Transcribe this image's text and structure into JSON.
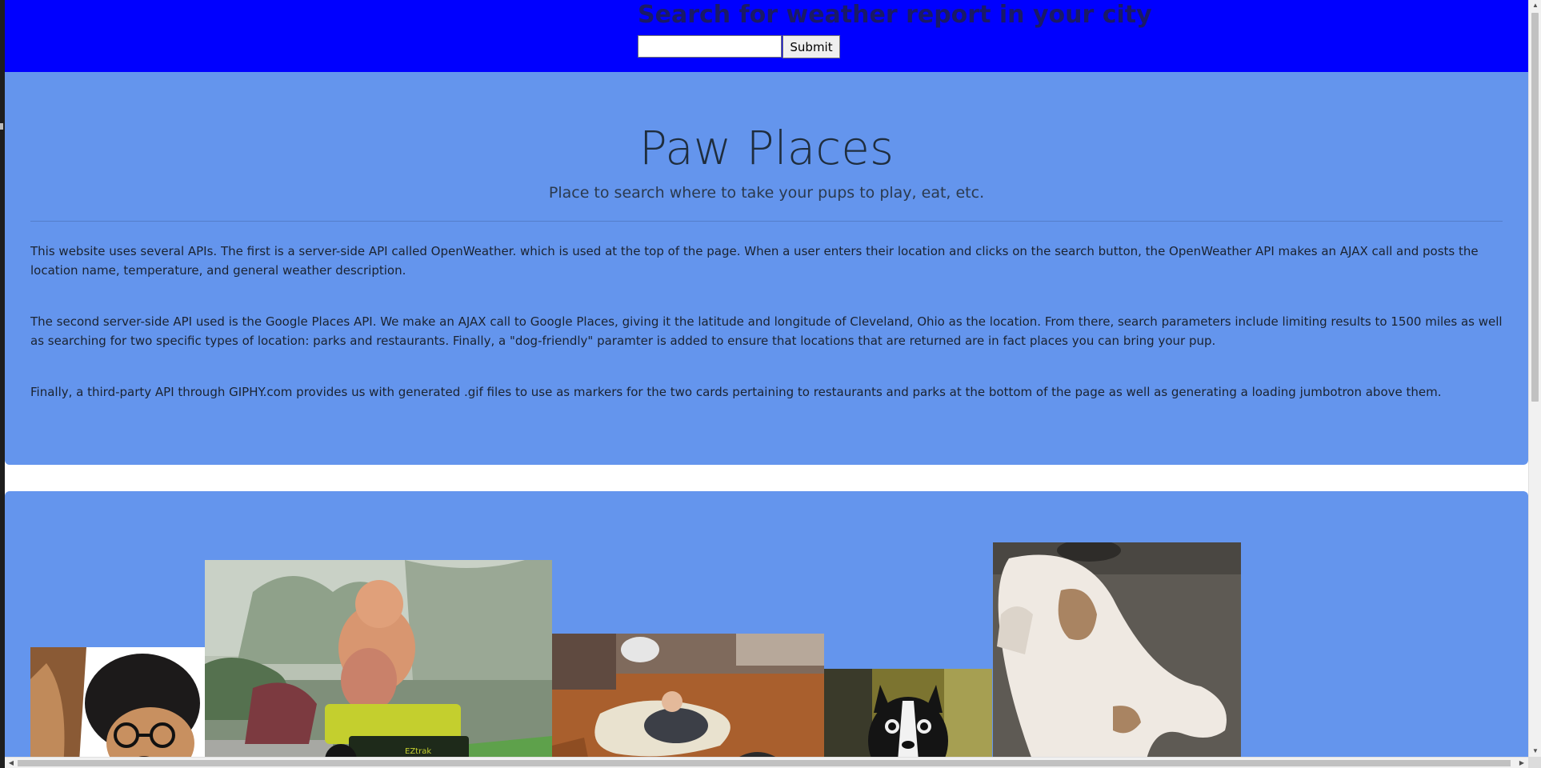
{
  "weather": {
    "title": "Search for weather report in your city",
    "input_value": "",
    "submit_label": "Submit"
  },
  "jumbotron": {
    "title": "Paw Places",
    "tagline": "Place to search where to take your pups to play, eat, etc.",
    "paragraphs": [
      "This website uses several APIs. The first is a server-side API called OpenWeather. which is used at the top of the page. When a user enters their location and clicks on the search button, the OpenWeather API makes an AJAX call and posts the location name, temperature, and general weather description.",
      "The second server-side API used is the Google Places API. We make an AJAX call to Google Places, giving it the latitude and longitude of Cleveland, Ohio as the location. From there, search parameters include limiting results to 1500 miles as well as searching for two specific types of location: parks and restaurants. Finally, a \"dog-friendly\" paramter is added to ensure that locations that are returned are in fact places you can bring your pup.",
      "Finally, a third-party API through GIPHY.com provides us with generated .gif files to use as markers for the two cards pertaining to restaurants and parks at the bottom of the page as well as generating a loading jumbotron above them."
    ]
  },
  "gifs": [
    {
      "icon": "dog-in-wig-and-glasses-gif"
    },
    {
      "icon": "poodle-riding-lawn-mower-gif"
    },
    {
      "icon": "child-hugging-dog-gif"
    },
    {
      "icon": "boston-terrier-gif"
    },
    {
      "icon": "puppy-crawling-gif"
    }
  ],
  "colors": {
    "header_bg": "#0000ff",
    "section_bg": "#6495ed",
    "title_text": "#1f2d3d"
  }
}
